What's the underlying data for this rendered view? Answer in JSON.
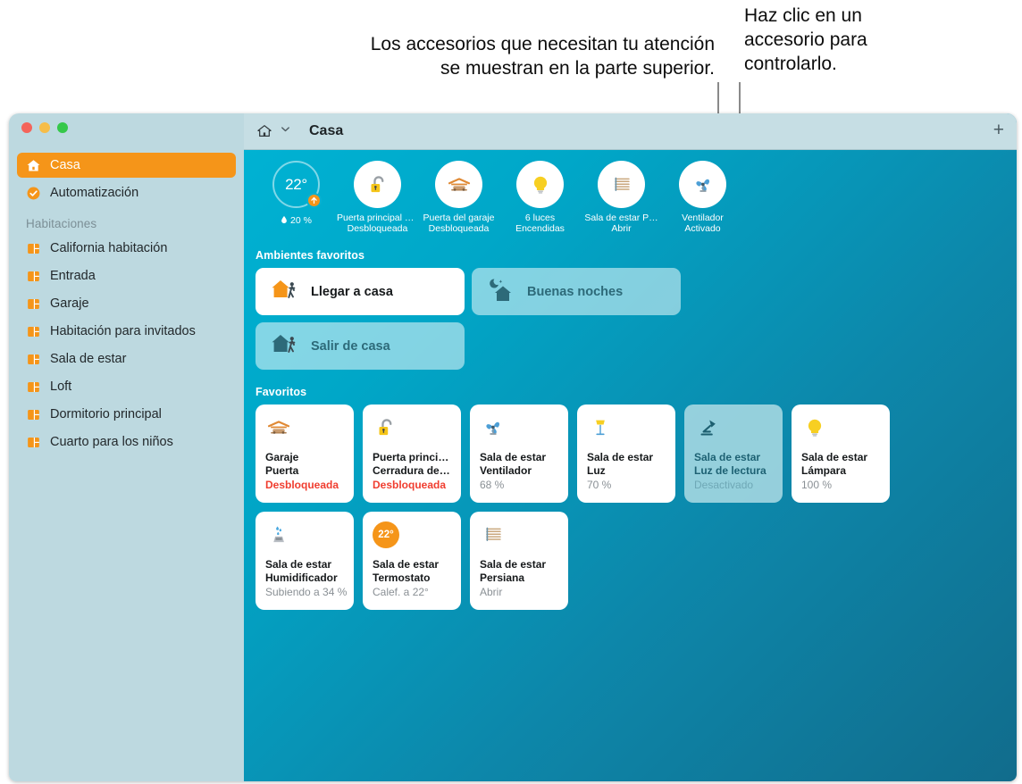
{
  "callouts": {
    "left": "Los accesorios que necesitan tu atención\nse muestran en la parte superior.",
    "right": "Haz clic en un\naccesorio para\ncontrolarlo."
  },
  "window": {
    "titlebar": {
      "home_icon": "home-icon",
      "chevron_icon": "chevron-down-icon",
      "title": "Casa",
      "add_label": "+"
    }
  },
  "sidebar": {
    "top_items": [
      {
        "label": "Casa",
        "icon": "home-icon",
        "selected": true
      },
      {
        "label": "Automatización",
        "icon": "automation-clock-icon",
        "selected": false
      }
    ],
    "rooms_header": "Habitaciones",
    "rooms": [
      {
        "label": "California habitación",
        "icon": "room-icon"
      },
      {
        "label": "Entrada",
        "icon": "room-icon"
      },
      {
        "label": "Garaje",
        "icon": "room-icon"
      },
      {
        "label": "Habitación para invitados",
        "icon": "room-icon"
      },
      {
        "label": "Sala de estar",
        "icon": "room-icon"
      },
      {
        "label": "Loft",
        "icon": "room-icon"
      },
      {
        "label": "Dormitorio principal",
        "icon": "room-icon"
      },
      {
        "label": "Cuarto para los niños",
        "icon": "room-icon"
      }
    ]
  },
  "status_strip": {
    "climate": {
      "temperature": "22°",
      "humidity": "20 %",
      "humidity_icon": "water-drop-icon",
      "trend_icon": "arrow-up-icon"
    },
    "items": [
      {
        "icon": "unlocked-padlock-icon",
        "line1": "Puerta principal C…",
        "line2": "Desbloqueada"
      },
      {
        "icon": "garage-door-icon",
        "line1": "Puerta del garaje",
        "line2": "Desbloqueada"
      },
      {
        "icon": "lightbulb-icon",
        "line1": "6 luces",
        "line2": "Encendidas"
      },
      {
        "icon": "window-blinds-icon",
        "line1": "Sala de estar P…",
        "line2": "Abrir"
      },
      {
        "icon": "fan-icon",
        "line1": "Ventilador",
        "line2": "Activado"
      }
    ]
  },
  "scenes": {
    "title": "Ambientes favoritos",
    "items": [
      {
        "label": "Llegar a casa",
        "icon": "house-arriving-icon",
        "state": "on"
      },
      {
        "label": "Buenas noches",
        "icon": "moon-house-icon",
        "state": "off"
      },
      {
        "label": "Salir de casa",
        "icon": "house-leaving-icon",
        "state": "off"
      }
    ]
  },
  "favorites": {
    "title": "Favoritos",
    "tiles": [
      {
        "icon": "garage-door-icon",
        "line1": "Garaje",
        "line2": "Puerta",
        "status": "Desbloqueada",
        "status_style": "alert",
        "state": "on"
      },
      {
        "icon": "unlocked-padlock-icon",
        "line1": "Puerta principal",
        "line2": "Cerradura de …",
        "status": "Desbloqueada",
        "status_style": "alert",
        "state": "on"
      },
      {
        "icon": "fan-icon",
        "line1": "Sala de estar",
        "line2": "Ventilador",
        "status": "68 %",
        "status_style": "normal",
        "state": "on"
      },
      {
        "icon": "floor-lamp-icon",
        "line1": "Sala de estar",
        "line2": "Luz",
        "status": "70 %",
        "status_style": "normal",
        "state": "on"
      },
      {
        "icon": "desk-lamp-icon",
        "line1": "Sala de estar",
        "line2": "Luz de lectura",
        "status": "Desactivado",
        "status_style": "normal",
        "state": "off"
      },
      {
        "icon": "lightbulb-icon",
        "line1": "Sala de estar",
        "line2": "Lámpara",
        "status": "100 %",
        "status_style": "normal",
        "state": "on"
      },
      {
        "icon": "humidifier-icon",
        "line1": "Sala de estar",
        "line2": "Humidificador",
        "status": "Subiendo a 34 %",
        "status_style": "normal",
        "state": "on"
      },
      {
        "icon": "thermostat-badge",
        "badge_text": "22°",
        "line1": "Sala de estar",
        "line2": "Termostato",
        "status": "Calef. a 22°",
        "status_style": "normal",
        "state": "on"
      },
      {
        "icon": "window-blinds-icon",
        "line1": "Sala de estar",
        "line2": "Persiana",
        "status": "Abrir",
        "status_style": "normal",
        "state": "on"
      }
    ]
  },
  "colors": {
    "accent_orange": "#f59519",
    "sidebar_bg": "#bdd9e0",
    "titlebar_bg": "#c6dee4",
    "alert_red": "#f03d2f",
    "content_teal": "#00a7c8"
  }
}
